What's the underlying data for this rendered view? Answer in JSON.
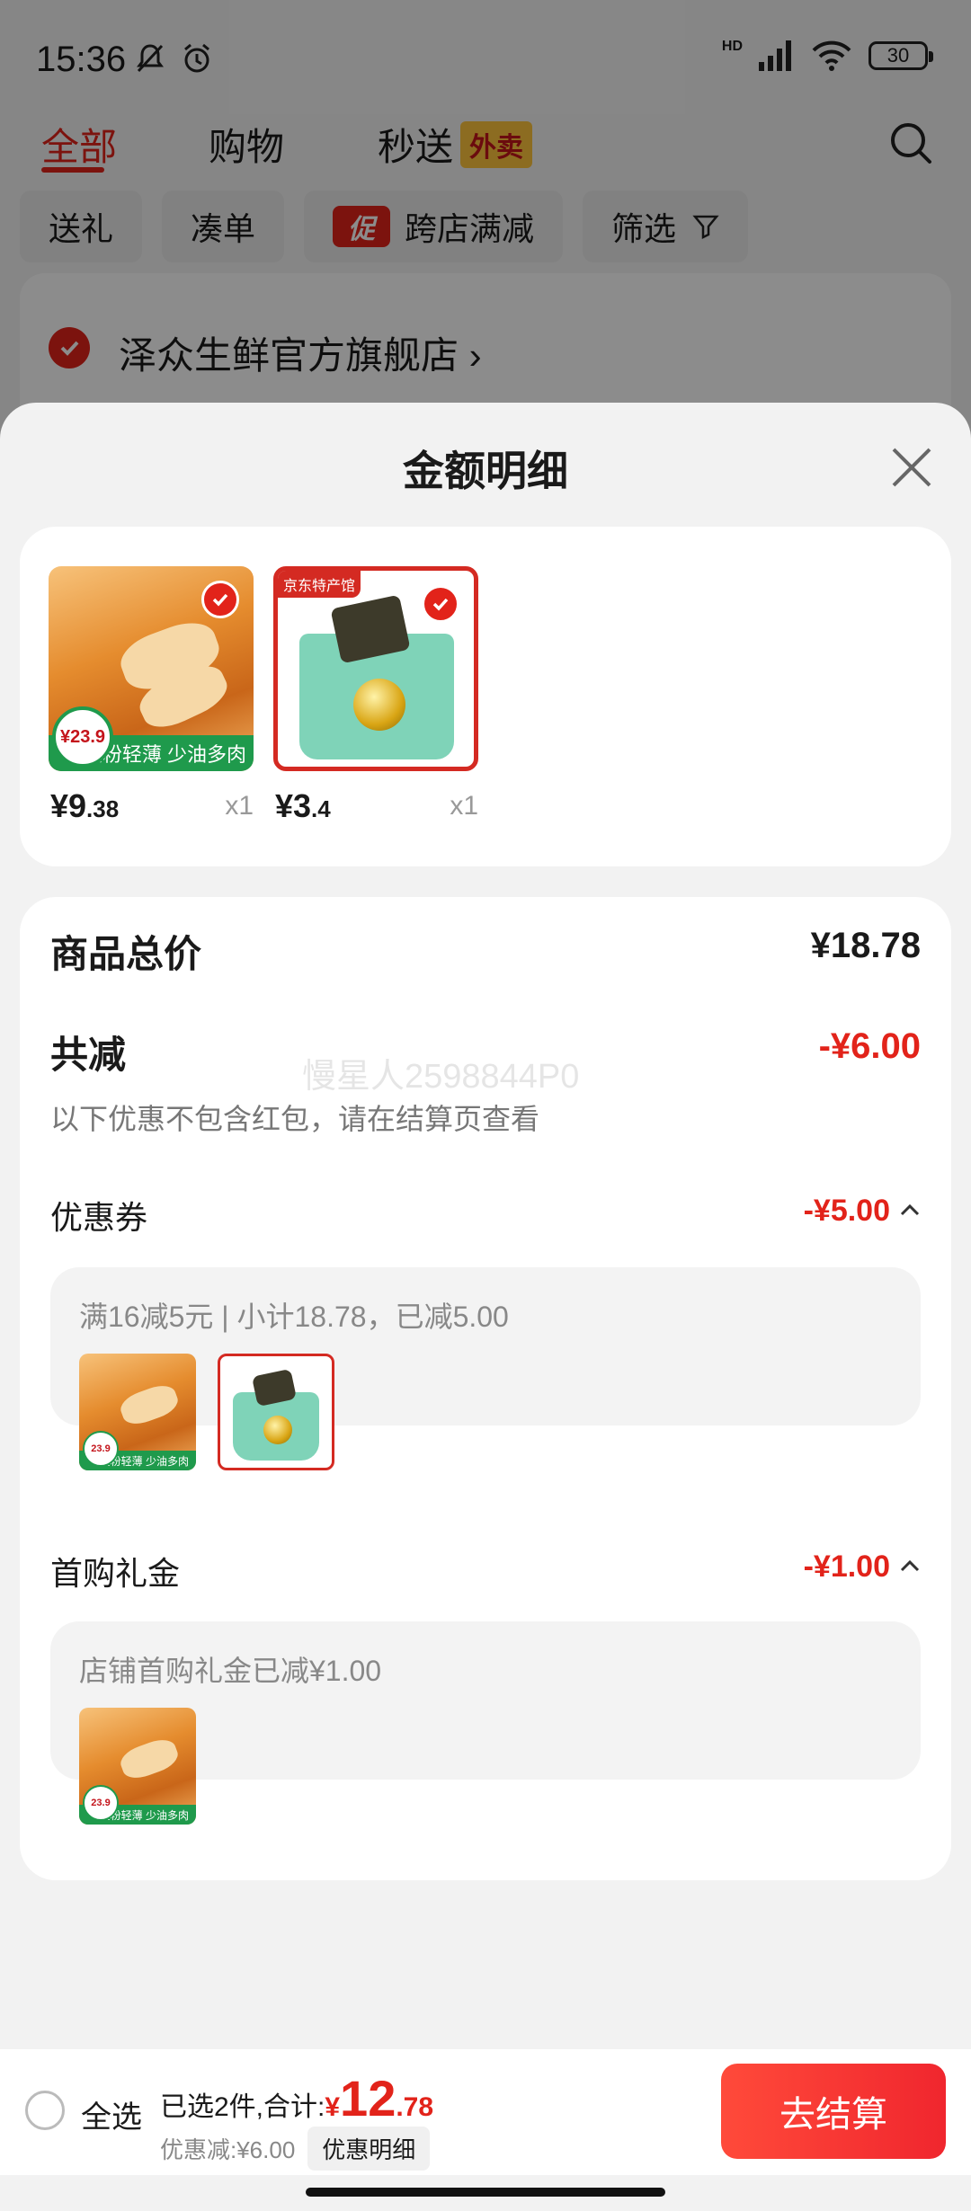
{
  "status_bar": {
    "time": "15:36",
    "battery": "30",
    "net": "HD"
  },
  "tabs": [
    {
      "label": "全部"
    },
    {
      "label": "购物"
    },
    {
      "label": "秒送",
      "badge": "外卖"
    }
  ],
  "filters": {
    "gift": "送礼",
    "bundle": "凑单",
    "promo_tag": "促",
    "cross_store": "跨店满减",
    "filter": "筛选"
  },
  "store": {
    "name": "泽众生鲜官方旗舰店"
  },
  "sheet": {
    "title": "金额明细",
    "products": [
      {
        "price_main": "¥9",
        "price_dec": ".38",
        "qty": "x1",
        "badge_price": "¥23.9"
      },
      {
        "price_main": "¥3",
        "price_dec": ".4",
        "qty": "x1",
        "badge_label": "京东特产馆"
      }
    ],
    "total_label": "商品总价",
    "total_value": "¥18.78",
    "reduce_label": "共减",
    "reduce_value": "-¥6.00",
    "watermark": "慢星人2598844P0",
    "hint": "以下优惠不包含红包，请在结算页查看",
    "coupon": {
      "label": "优惠券",
      "value": "-¥5.00",
      "detail": "满16减5元 | 小计18.78，已减5.00"
    },
    "gift": {
      "label": "首购礼金",
      "value": "-¥1.00",
      "detail": "店铺首购礼金已减¥1.00"
    }
  },
  "bottom": {
    "select_all": "全选",
    "selected_text": "已选2件,合计:",
    "currency": "¥",
    "total_int": "12",
    "total_dec": ".78",
    "discount_text": "优惠减:¥6.00",
    "detail_chip": "优惠明细",
    "checkout": "去结算"
  },
  "colors": {
    "accent": "#e2231a",
    "badge_yellow": "#ffc53d"
  }
}
